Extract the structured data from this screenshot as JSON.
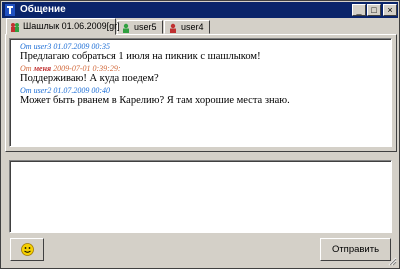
{
  "window": {
    "title": "Общение",
    "buttons": {
      "minimize": "_",
      "maximize": "□",
      "close": "×"
    }
  },
  "tabs": [
    {
      "label": "Шашлык 01.06.2009[gr]",
      "active": true,
      "icon": "group-chat-icon"
    },
    {
      "label": "user5",
      "active": false,
      "icon": "user-icon"
    },
    {
      "label": "user4",
      "active": false,
      "icon": "user-icon"
    }
  ],
  "messages": [
    {
      "from_prefix": "От",
      "sender": "user3",
      "timestamp": "01.07.2009 00:35",
      "text": "Предлагаю собраться 1 июля на пикник с шашлыком!",
      "header_color": "#1e6fd6"
    },
    {
      "from_prefix": "От",
      "sender": "меня",
      "timestamp": "2009-07-01 0:39:29:",
      "text": "Поддерживаю! А куда поедем?",
      "header_color": "#d26a3c"
    },
    {
      "from_prefix": "От",
      "sender": "user2",
      "timestamp": "01.07.2009 00:40",
      "text": "Может быть рванем в Карелию? Я там хорошие места знаю.",
      "header_color": "#1e6fd6"
    }
  ],
  "input": {
    "value": ""
  },
  "buttons": {
    "send_label": "Отправить",
    "smiley_icon": "smiley-icon"
  },
  "colors": {
    "titlebar": "#0a246a",
    "face": "#d4d0c8",
    "incoming": "#1e6fd6",
    "outgoing": "#d26a3c"
  }
}
